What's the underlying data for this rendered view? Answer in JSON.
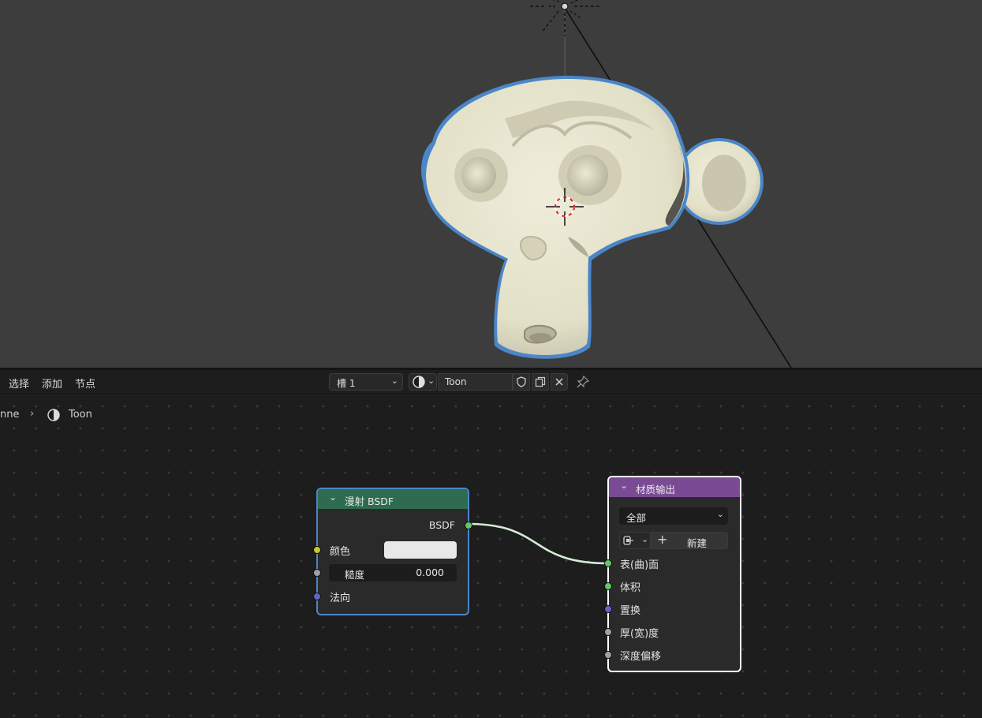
{
  "menu": {
    "select": "选择",
    "add": "添加",
    "node": "节点"
  },
  "slot_dropdown": {
    "value": "槽 1"
  },
  "material": {
    "name": "Toon"
  },
  "breadcrumb": {
    "object": "nne",
    "material": "Toon"
  },
  "diffuse_node": {
    "title": "漫射 BSDF",
    "output": "BSDF",
    "color_label": "颜色",
    "roughness_label": "糙度",
    "roughness_value": "0.000",
    "normal_label": "法向",
    "header_color": "#2e6b4f"
  },
  "output_node": {
    "title": "材质输出",
    "target": "全部",
    "new_label": "新建",
    "inputs": [
      "表(曲)面",
      "体积",
      "置换",
      "厚(宽)度",
      "深度偏移"
    ],
    "header_color": "#7a4b94"
  },
  "colors": {
    "selection_outline": "#4a86c8",
    "active_outline": "#ffffff",
    "shader_socket": "#63c763",
    "color_socket": "#c7c729",
    "float_socket": "#a1a1a1",
    "vector_socket": "#6363c7"
  },
  "icons": {
    "material_preview": "material-sphere-icon",
    "fake_user": "shield-icon",
    "duplicate": "duplicate-icon",
    "unlink": "close-icon",
    "pin": "pin-icon"
  }
}
